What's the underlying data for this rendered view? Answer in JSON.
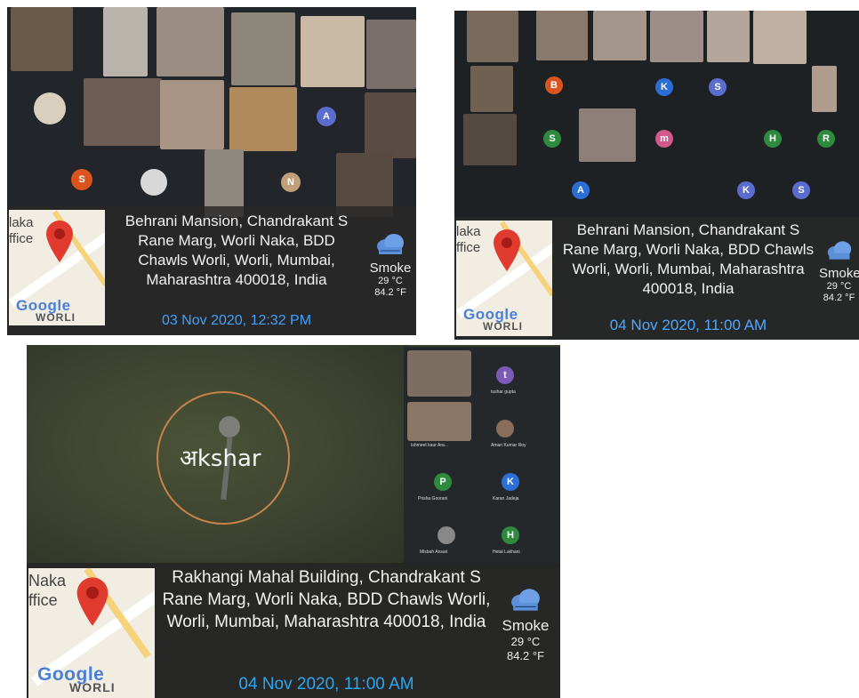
{
  "photos": [
    {
      "address": "Behrani Mansion, Chandrakant S Rane Marg, Worli Naka, BDD Chawls Worli, Worli, Mumbai, Maharashtra 400018, India",
      "datetime": "03 Nov 2020, 12:32 PM",
      "weather": {
        "condition": "Smoke",
        "temp_c": "29 °C",
        "temp_f": "84.2 °F"
      },
      "map": {
        "label_top": "laka",
        "label_mid": "ffice",
        "brand": "Google",
        "place": "WORLI"
      },
      "avatars": [
        "A",
        "S",
        "N"
      ]
    },
    {
      "address": "Behrani Mansion, Chandrakant S Rane Marg, Worli Naka, BDD Chawls Worli, Worli, Mumbai, Maharashtra 400018, India",
      "datetime": "04 Nov 2020, 11:00 AM",
      "weather": {
        "condition": "Smoke",
        "temp_c": "29 °C",
        "temp_f": "84.2 °F"
      },
      "map": {
        "label_top": "laka",
        "label_mid": "ffice",
        "brand": "Google",
        "place": "WORLI"
      },
      "avatars": [
        "B",
        "K",
        "S",
        "S",
        "m",
        "H",
        "R",
        "A",
        "K",
        "S"
      ]
    },
    {
      "address": "Rakhangi Mahal Building, Chandrakant S Rane Marg, Worli Naka, BDD Chawls Worli, Worli, Mumbai, Maharashtra 400018, India",
      "datetime": "04 Nov 2020, 11:00 AM",
      "weather": {
        "condition": "Smoke",
        "temp_c": "29 °C",
        "temp_f": "84.2 °F"
      },
      "map": {
        "label_top": "Naka",
        "label_mid": "ffice",
        "brand": "Google",
        "place": "WORLI"
      },
      "speaker": "अkshar",
      "participants": [
        {
          "initial": "t",
          "name": "tushar gupta",
          "color": "#7b5bb5"
        },
        {
          "initial": "",
          "name": "Ishmeet kaur Ara...",
          "color": "#555"
        },
        {
          "initial": "",
          "name": "Aman Kumar Roy",
          "color": "#8a6d5a"
        },
        {
          "initial": "P",
          "name": "Prisha Goorani",
          "color": "#2e8b3e"
        },
        {
          "initial": "K",
          "name": "Karan Jadeja",
          "color": "#2b6fd6"
        },
        {
          "initial": "",
          "name": "Misbah Ansari",
          "color": "#888"
        },
        {
          "initial": "H",
          "name": "Hetal Lakhani",
          "color": "#2e8b3e"
        }
      ]
    }
  ]
}
